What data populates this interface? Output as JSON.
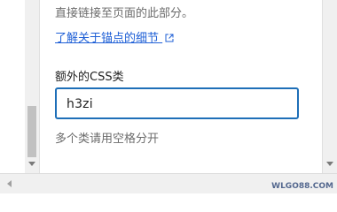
{
  "panel": {
    "description": "直接链接至页面的此部分。",
    "learn_link": "了解关于锚点的细节",
    "css_label": "额外的CSS类",
    "css_value": "h3zi",
    "css_help": "多个类请用空格分开"
  },
  "icons": {
    "external_link": "external-link-icon"
  },
  "watermark": "WLGO88.COM",
  "colors": {
    "link": "#1e5fd6",
    "focus_border": "#1e6fb8",
    "muted_text": "#6b6b6b"
  }
}
